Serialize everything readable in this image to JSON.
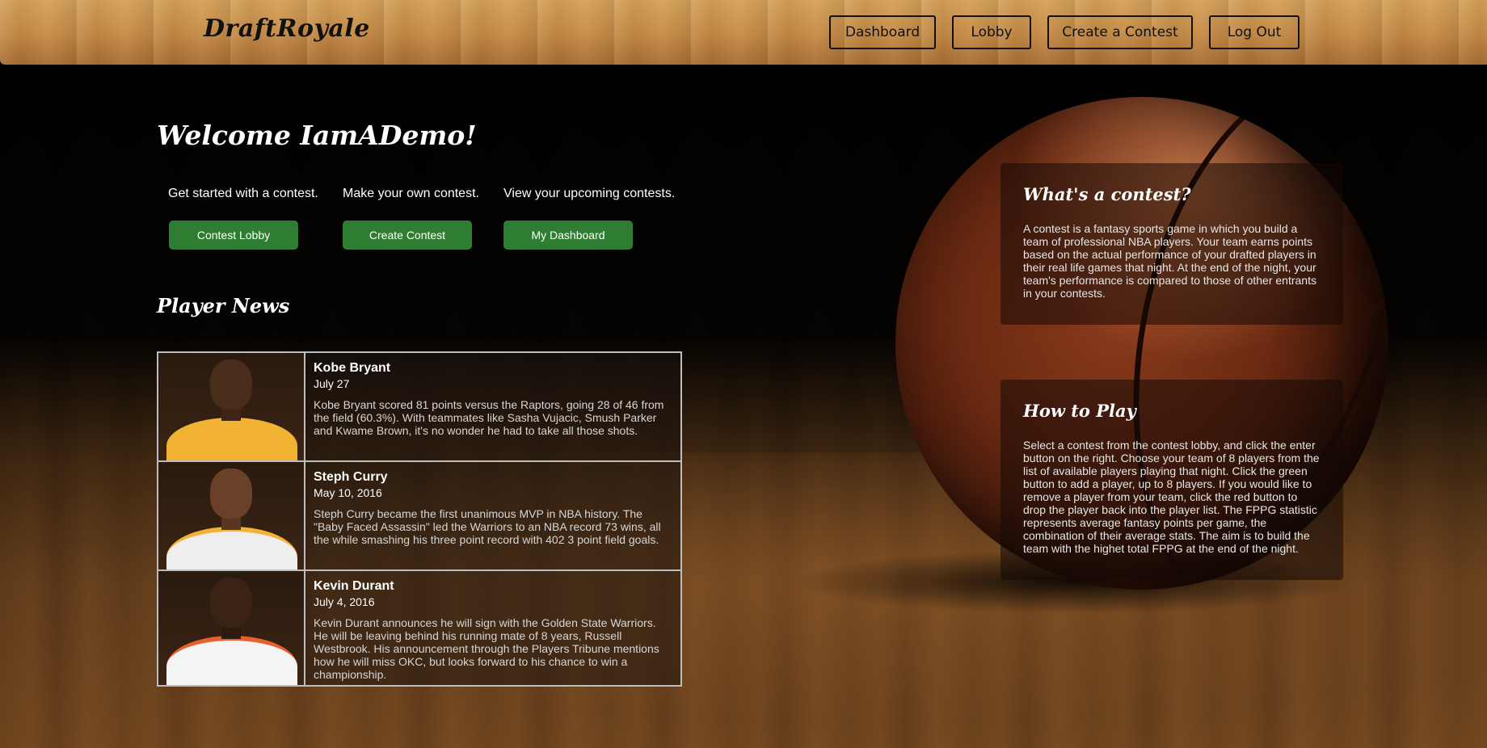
{
  "header": {
    "brand": "DraftRoyale",
    "nav": {
      "dashboard": "Dashboard",
      "lobby": "Lobby",
      "create": "Create a Contest",
      "logout": "Log Out"
    }
  },
  "main": {
    "welcome": "Welcome IamADemo!",
    "ctas": [
      {
        "text": "Get started with a contest.",
        "button": "Contest Lobby"
      },
      {
        "text": "Make your own contest.",
        "button": "Create Contest"
      },
      {
        "text": "View your upcoming contests.",
        "button": "My Dashboard"
      }
    ],
    "news_title": "Player News",
    "news": [
      {
        "name": "Kobe Bryant",
        "date": "July 27",
        "text": "Kobe Bryant scored 81 points versus the Raptors, going 28 of 46 from the field (60.3%). With teammates like Sasha Vujacic, Smush Parker and Kwame Brown, it's no wonder he had to take all those shots."
      },
      {
        "name": "Steph Curry",
        "date": "May 10, 2016",
        "text": "Steph Curry became the first unanimous MVP in NBA history. The \"Baby Faced Assassin\" led the Warriors to an NBA record 73 wins, all the while smashing his three point record with 402 3 point field goals."
      },
      {
        "name": "Kevin Durant",
        "date": "July 4, 2016",
        "text": "Kevin Durant announces he will sign with the Golden State Warriors. He will be leaving behind his running mate of 8 years, Russell Westbrook. His announcement through the Players Tribune mentions how he will miss OKC, but looks forward to his chance to win a championship."
      }
    ]
  },
  "sidebar": {
    "contest": {
      "title": "What's a contest?",
      "text": "A contest is a fantasy sports game in which you build a team of professional NBA players. Your team earns points based on the actual performance of your drafted players in their real life games that night. At the end of the night, your team's performance is compared to those of other entrants in your contests."
    },
    "howto": {
      "title": "How to Play",
      "text": "Select a contest from the contest lobby, and click the enter button on the right. Choose your team of 8 players from the list of available players playing that night. Click the green button to add a player, up to 8 players. If you would like to remove a player from your team, click the red button to drop the player back into the player list. The FPPG statistic represents average fantasy points per game, the combination of their average stats. The aim is to build the team with the highet total FPPG at the end of the night."
    }
  },
  "colors": {
    "cta_green": "#2e7d32",
    "kobe_jersey": "#f2b233",
    "curry_jersey": "#eeeeee",
    "durant_jersey": "#f4f4f4"
  }
}
